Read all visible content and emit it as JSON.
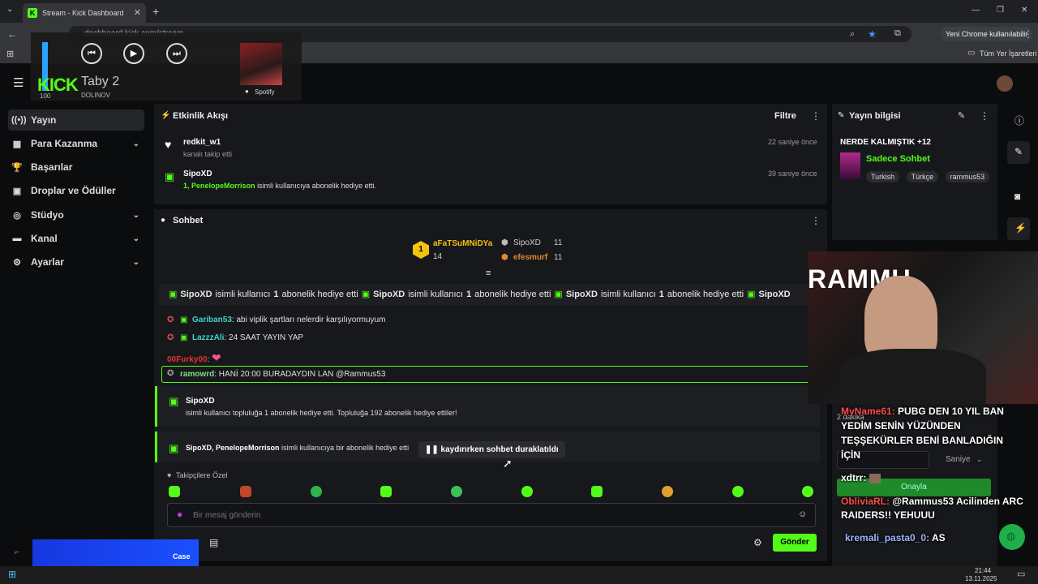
{
  "browser": {
    "tab_title": "Stream - Kick Dashboard",
    "url": "dashboard.kick.com/stream",
    "profile_button": "Yeni Chrome kullanılabilir",
    "bookmarks_label": "Tüm Yer İşaretleri"
  },
  "spotify": {
    "song_title": "Taby 2",
    "artist": "DOLINOV",
    "volume": 100,
    "brand": "Spotify"
  },
  "kick": {
    "logo": "KICK"
  },
  "sidebar": {
    "items": [
      {
        "label": "Yayın",
        "icon": "broadcast-icon",
        "glyph": "((•))",
        "expandable": false,
        "active": true
      },
      {
        "label": "Para Kazanma",
        "icon": "money-icon",
        "glyph": "▦",
        "expandable": true,
        "active": false
      },
      {
        "label": "Başarılar",
        "icon": "trophy-icon",
        "glyph": "🏆",
        "expandable": false,
        "active": false
      },
      {
        "label": "Droplar ve Ödüller",
        "icon": "gift-icon",
        "glyph": "▣",
        "expandable": false,
        "active": false
      },
      {
        "label": "Stüdyo",
        "icon": "studio-icon",
        "glyph": "◎",
        "expandable": true,
        "active": false
      },
      {
        "label": "Kanal",
        "icon": "channel-icon",
        "glyph": "▬",
        "expandable": true,
        "active": false
      },
      {
        "label": "Ayarlar",
        "icon": "gear-icon",
        "glyph": "⚙",
        "expandable": true,
        "active": false
      }
    ]
  },
  "activity": {
    "title": "Etkinlik Akışı",
    "filter": "Filtre",
    "items": [
      {
        "user": "redkit_w1",
        "desc": "kanalı takip etti",
        "time": "22 saniye önce",
        "icon": "heart-icon"
      },
      {
        "user": "SipoXD",
        "desc_count": "1,",
        "desc_user": "PenelopeMorrison",
        "desc": "isimli kullanıcıya abonelik hediye etti.",
        "time": "39 saniye önce",
        "icon": "gift-icon"
      }
    ]
  },
  "chat": {
    "title": "Sohbet",
    "leaderboard": [
      {
        "rank": "1",
        "name": "aFaTSuMNiDYa",
        "count": "14"
      },
      {
        "name": "SipoXD",
        "count": "11"
      },
      {
        "name": "efesmurf",
        "count": "11"
      }
    ],
    "ticker": [
      {
        "user": "SipoXD",
        "mid": "isimli kullanıcı",
        "count": "1",
        "end": "abonelik hediye etti"
      },
      {
        "user": "SipoXD",
        "mid": "isimli kullanıcı",
        "count": "1",
        "end": "abonelik hediye etti"
      },
      {
        "user": "SipoXD",
        "mid": "isimli kullanıcı",
        "count": "1",
        "end": "abonelik hediye etti"
      },
      {
        "user": "SipoXD"
      }
    ],
    "messages": [
      {
        "user": "Gariban53",
        "text": "abi viplik şartları nelerdir karşılıyormuyum"
      },
      {
        "user": "LazzzAli",
        "text": "24 SAAT YAYIN YAP"
      },
      {
        "user": "00Furky00",
        "text": ""
      },
      {
        "user": "ramowrd",
        "text": "HANİ 20:00 BURADAYDIN LAN @Rammus53"
      }
    ],
    "gift_event": {
      "user": "SipoXD",
      "text": "isimli kullanıcı topluluğa 1 abonelik hediye etti. Topluluğa 192 abonelik hediye ettiler!"
    },
    "gift_event2": {
      "users": "SipoXD, PenelopeMorrison",
      "text": "isimli kullanıcıya bir abonelik hediye etti"
    },
    "paused": "kaydırırken sohbet duraklatıldı",
    "followers_only": "Takipçilere Özel",
    "input_placeholder": "Bir mesaj gönderin",
    "send": "Gönder"
  },
  "stream_info": {
    "title": "Yayın bilgisi",
    "stream_title": "NERDE KALMIŞTIK +12",
    "category": "Sadece Sohbet",
    "tags": [
      "Turkish",
      "Türkçe",
      "rammus53"
    ]
  },
  "overlay_chat": [
    {
      "user": "MyName61:",
      "text": "PUBG DEN 10 YIL BAN YEDİM SENİN YÜZÜNDEN TEŞŞEKÜRLER BENİ BANLADIĞIN İÇİN",
      "color": "#ff4d4d"
    },
    {
      "user": "xdtrr:",
      "text": "",
      "color": "#ffffff"
    },
    {
      "user": "ObliviaRL:",
      "text": "@Rammus53 Acilinden ARC RAIDERS!! YEHUUU",
      "color": "#ff4d4d"
    },
    {
      "user": "kremali_pasta0_0:",
      "text": "AS",
      "color": "#9db4ff"
    }
  ],
  "overlay_misc": {
    "minutes": "2 dakika",
    "unit_select": "Saniye",
    "approve": "Onayla",
    "webcam_sign": "RAMMU"
  },
  "taskbar": {
    "time": "21:44",
    "date": "13.11.2025"
  }
}
